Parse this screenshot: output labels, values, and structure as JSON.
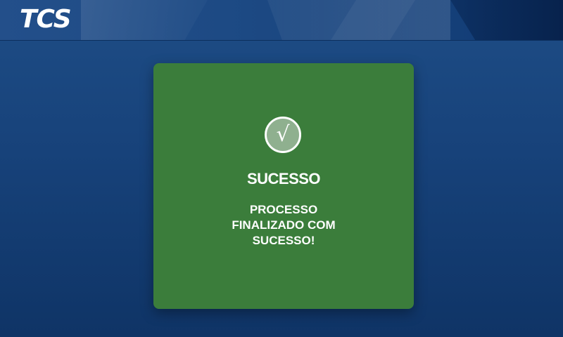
{
  "header": {
    "logo_text": "TCS"
  },
  "dialog": {
    "status_icon": "check-icon",
    "check_glyph": "√",
    "title": "SUCESSO",
    "message": "PROCESSO FINALIZADO COM SUCESSO!"
  },
  "colors": {
    "background": "#17427a",
    "card_background": "#3b7d3b",
    "text": "#ffffff"
  }
}
